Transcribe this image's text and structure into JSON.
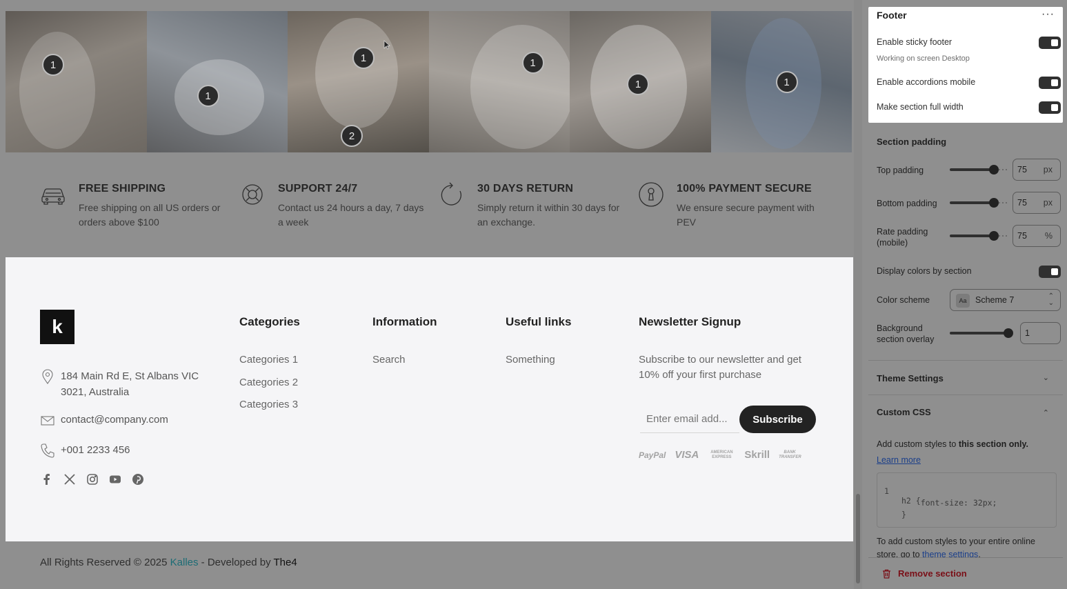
{
  "instagram": {
    "hotspots": [
      "1",
      "1",
      "1",
      "2",
      "1",
      "1",
      "1"
    ]
  },
  "features": [
    {
      "icon": "car-icon",
      "title": "FREE SHIPPING",
      "desc": "Free shipping on all US orders or orders above $100"
    },
    {
      "icon": "lifebuoy-icon",
      "title": "SUPPORT 24/7",
      "desc": "Contact us 24 hours a day, 7 days a week"
    },
    {
      "icon": "refresh-icon",
      "title": "30 DAYS RETURN",
      "desc": "Simply return it within 30 days for an exchange."
    },
    {
      "icon": "keyhole-icon",
      "title": "100% PAYMENT SECURE",
      "desc": "We ensure secure payment with PEV"
    }
  ],
  "footer": {
    "logo_letter": "k",
    "address": "184 Main Rd E, St Albans VIC 3021, Australia",
    "email": "contact@company.com",
    "phone": "+001 2233 456",
    "socials": [
      "facebook-icon",
      "x-twitter-icon",
      "instagram-icon",
      "youtube-icon",
      "pinterest-icon"
    ],
    "columns": [
      {
        "heading": "Categories",
        "links": [
          "Categories 1",
          "Categories 2",
          "Categories 3"
        ]
      },
      {
        "heading": "Information",
        "links": [
          "Search"
        ]
      },
      {
        "heading": "Useful links",
        "links": [
          "Something"
        ]
      }
    ],
    "newsletter": {
      "heading": "Newsletter Signup",
      "desc": "Subscribe to our newsletter and get 10% off your first purchase",
      "placeholder": "Enter email add...",
      "button": "Subscribe"
    },
    "payments": [
      "PayPal",
      "VISA",
      "AMERICAN EXPRESS",
      "Skrill",
      "BANK TRANSFER"
    ]
  },
  "copyright": {
    "prefix": "All Rights Reserved © 2025 ",
    "brand": "Kalles",
    "middle": " - Developed by ",
    "dev": "The4"
  },
  "panel": {
    "title": "Footer",
    "more": "···",
    "sticky_label": "Enable sticky footer",
    "sticky_sub": "Working on screen Desktop",
    "accordions_label": "Enable accordions mobile",
    "full_width_label": "Make section full width",
    "padding_heading": "Section padding",
    "top_padding": {
      "label": "Top padding",
      "value": "75",
      "unit": "px",
      "level": 0.75
    },
    "bottom_padding": {
      "label": "Bottom padding",
      "value": "75",
      "unit": "px",
      "level": 0.75
    },
    "rate_padding": {
      "label": "Rate padding (mobile)",
      "value": "75",
      "unit": "%",
      "level": 0.75
    },
    "display_colors_label": "Display colors by section",
    "color_scheme_label": "Color scheme",
    "color_scheme_swatch": "Aa",
    "color_scheme_value": "Scheme 7",
    "overlay": {
      "label": "Background section overlay",
      "value": "1",
      "level": 1.0
    },
    "theme_settings": "Theme Settings",
    "custom_css": "Custom CSS",
    "css_desc_prefix": "Add custom styles to ",
    "css_desc_bold": "this section only.",
    "learn_more": "Learn more",
    "code": {
      "line_no": "1",
      "lines": [
        "h2 {",
        "    font-size: 32px;",
        "}"
      ]
    },
    "css_foot_prefix": "To add custom styles to your entire online store, go to ",
    "css_foot_link": "theme settings",
    "css_foot_suffix": ".",
    "remove": "Remove section"
  }
}
